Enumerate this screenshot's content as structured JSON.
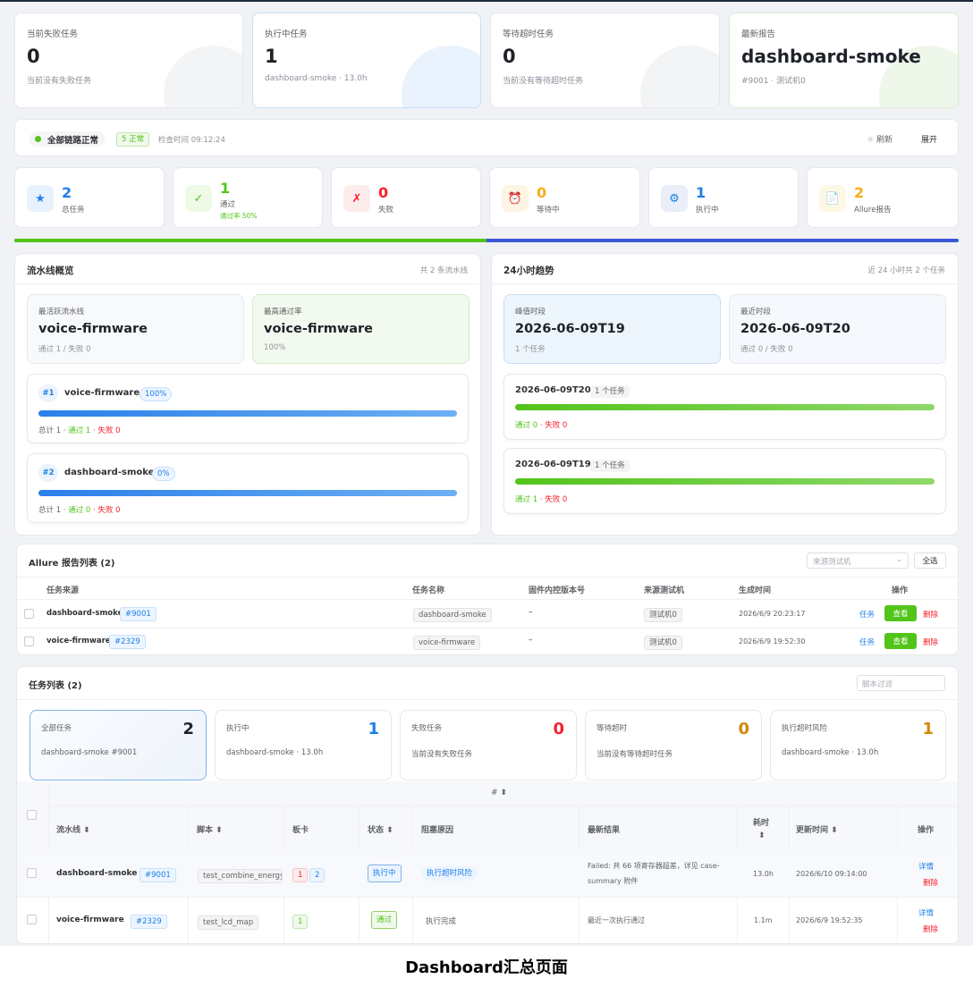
{
  "summary": [
    {
      "title": "当前失败任务",
      "value": "0",
      "sub": "当前没有失败任务"
    },
    {
      "title": "执行中任务",
      "value": "1",
      "sub": "dashboard-smoke · 13.0h"
    },
    {
      "title": "等待超时任务",
      "value": "0",
      "sub": "当前没有等待超时任务"
    },
    {
      "title": "最新报告",
      "value": "dashboard-smoke",
      "sub": "#9001 · 测试机0"
    }
  ],
  "status_bar": {
    "label": "全部链路正常",
    "badge": "5 正常",
    "check_time": "检查时间 09:12:24",
    "refresh": "刷新",
    "expand": "展开"
  },
  "stats": [
    {
      "icon": "★",
      "icon_name": "star-icon",
      "value": "2",
      "label": "总任务",
      "color": "#1e7fe8",
      "bg": "#e6f2fd"
    },
    {
      "icon": "✓",
      "icon_name": "check-icon",
      "value": "1",
      "label": "通过",
      "sub": "通过率 50%",
      "color": "#52c41a",
      "bg": "#eef9e6"
    },
    {
      "icon": "✗",
      "icon_name": "cross-icon",
      "value": "0",
      "label": "失败",
      "color": "#f5222d",
      "bg": "#fdecec"
    },
    {
      "icon": "⏰",
      "icon_name": "alarm-clock-icon",
      "value": "0",
      "label": "等待中",
      "color": "#faad14",
      "bg": "#fdf5e3"
    },
    {
      "icon": "⚙",
      "icon_name": "gear-icon",
      "value": "1",
      "label": "执行中",
      "color": "#1e7fe8",
      "bg": "#e9eef9"
    },
    {
      "icon": "📄",
      "icon_name": "document-icon",
      "value": "2",
      "label": "Allure报告",
      "color": "#faad14",
      "bg": "#fdf8e6"
    }
  ],
  "progress": {
    "pass_fraction": 0.5,
    "pass_color": "#52c41a",
    "run_color": "#3a58d6"
  },
  "pipeline": {
    "title": "流水线概览",
    "count": "共 2 条流水线",
    "most_active": {
      "title": "最活跃流水线",
      "value": "voice-firmware",
      "sub": "通过 1 / 失败 0"
    },
    "best_rate": {
      "title": "最高通过率",
      "value": "voice-firmware",
      "sub": "100%"
    },
    "items": [
      {
        "rank": "#1",
        "name": "voice-firmware",
        "pct": "100%",
        "total": "总计 1 · ",
        "pass": "通过 1",
        "fail": " · 失败 0"
      },
      {
        "rank": "#2",
        "name": "dashboard-smoke",
        "pct": "0%",
        "total": "总计 1 · ",
        "pass": "通过 0",
        "fail": " · 失败 0"
      }
    ]
  },
  "trend": {
    "title": "24小时趋势",
    "count": "近 24 小时共 2 个任务",
    "peak": {
      "title": "峰值时段",
      "value": "2026-06-09T19",
      "sub": "1 个任务"
    },
    "recent": {
      "title": "最近时段",
      "value": "2026-06-09T20",
      "sub": "通过 0 / 失败 0"
    },
    "items": [
      {
        "time": "2026-06-09T20",
        "count": "1 个任务",
        "pass": "通过 0",
        "fail": " · 失败 0"
      },
      {
        "time": "2026-06-09T19",
        "count": "1 个任务",
        "pass": "通过 1",
        "fail": " · 失败 0"
      }
    ]
  },
  "allure": {
    "title": "Allure 报告列表 (2)",
    "source_placeholder": "来源测试机",
    "select_all": "全选",
    "headers": [
      "任务来源",
      "任务名称",
      "固件内控版本号",
      "来源测试机",
      "生成时间",
      "操作"
    ],
    "rows": [
      {
        "src": "dashboard-smoke",
        "id": "#9001",
        "name": "dashboard-smoke",
        "ver": "–",
        "machine": "测试机0",
        "time": "2026/6/9 20:23:17",
        "a1": "任务",
        "a2": "查看",
        "a3": "删除"
      },
      {
        "src": "voice-firmware",
        "id": "#2329",
        "name": "voice-firmware",
        "ver": "–",
        "machine": "测试机0",
        "time": "2026/6/9 19:52:30",
        "a1": "任务",
        "a2": "查看",
        "a3": "删除"
      }
    ]
  },
  "tasks": {
    "title": "任务列表 (2)",
    "filter_placeholder": "脚本过滤",
    "cards": [
      {
        "title": "全部任务",
        "value": "2",
        "sub": "dashboard-smoke #9001",
        "color": "#1f2329"
      },
      {
        "title": "执行中",
        "value": "1",
        "sub": "dashboard-smoke · 13.0h",
        "color": "#1e7fe8"
      },
      {
        "title": "失败任务",
        "value": "0",
        "sub": "当前没有失败任务",
        "color": "#f5222d"
      },
      {
        "title": "等待超时",
        "value": "0",
        "sub": "当前没有等待超时任务",
        "color": "#d48806"
      },
      {
        "title": "执行超时风险",
        "value": "1",
        "sub": "dashboard-smoke · 13.0h",
        "color": "#d48806"
      }
    ],
    "group_header": "# ⬍",
    "headers": [
      "流水线 ⬍",
      "脚本 ⬍",
      "板卡",
      "状态 ⬍",
      "阻塞原因",
      "最新结果",
      "耗时",
      "⬍",
      "更新时间 ⬍",
      "操作"
    ],
    "rows": [
      {
        "pipe": "dashboard-smoke",
        "id": "#9001",
        "script": "test_combine_energy",
        "b1": "1",
        "b2": "2",
        "status": "执行中",
        "reason": "执行超时风险",
        "result1": "Failed: 共 66 项寄存器超差，详见 case-",
        "result2": "summary 附件",
        "dur": "13.0h",
        "time": "2026/6/10 09:14:00",
        "a1": "详情",
        "a2": "删除"
      },
      {
        "pipe": "voice-firmware",
        "id": "#2329",
        "script": "test_lcd_map",
        "b1": "1",
        "status": "通过",
        "reason": "执行完成",
        "result1": "最近一次执行通过",
        "dur": "1.1m",
        "time": "2026/6/9 19:52:35",
        "a1": "详情",
        "a2": "删除"
      }
    ]
  },
  "caption": "Dashboard汇总页面"
}
